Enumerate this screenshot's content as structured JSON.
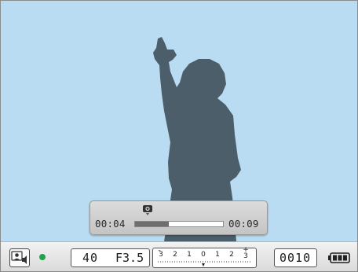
{
  "playback": {
    "elapsed_time": "00:04",
    "total_time": "00:09",
    "progress_fraction": 0.38,
    "icon": "camera-icon"
  },
  "status_bar": {
    "mode_icon": "smart-face-audio-icon",
    "rec_indicator_color": "#1fa24a",
    "shutter_speed": "40",
    "aperture": "F3.5",
    "exposure_scale": {
      "minus_label": "-",
      "plus_label": "+",
      "labels": [
        "3",
        "2",
        "1",
        "0",
        "1",
        "2",
        "3"
      ],
      "value": 0
    },
    "shot_counter": "0010",
    "battery_icon": "battery-full-icon"
  },
  "colors": {
    "sky": "#b9dcf2",
    "silhouette": "#4b5e6a"
  }
}
